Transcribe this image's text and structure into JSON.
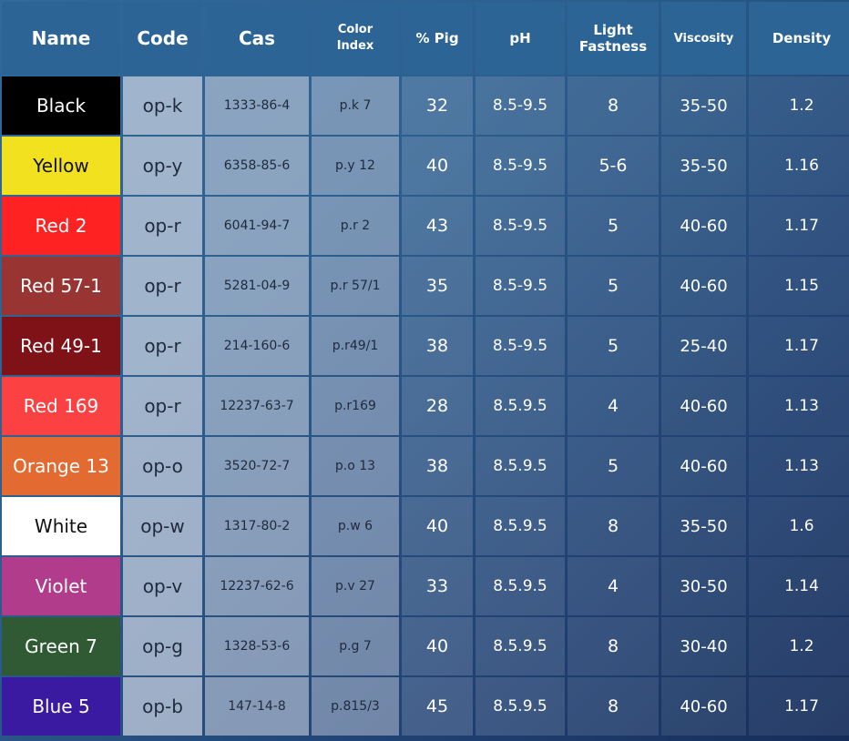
{
  "headers": [
    "Name",
    "Code",
    "Cas",
    "Color\nIndex",
    "% Pig",
    "pH",
    "Light\nFastness",
    "Viscosity",
    "Density"
  ],
  "rows": [
    {
      "name": "Black",
      "color": "#000000",
      "code": "op-k",
      "cas": "1333-86-4",
      "color_index": "p.k 7",
      "pig": "32",
      "ph": "8.5-9.5",
      "light_fastness": "8",
      "viscosity": "35-50",
      "density": "1.2"
    },
    {
      "name": "Yellow",
      "color": "#f2e11f",
      "code": "op-y",
      "cas": "6358-85-6",
      "color_index": "p.y 12",
      "pig": "40",
      "ph": "8.5-9.5",
      "light_fastness": "5-6",
      "viscosity": "35-50",
      "density": "1.16"
    },
    {
      "name": "Red 2",
      "color": "#ff2222",
      "code": "op-r",
      "cas": "6041-94-7",
      "color_index": "p.r 2",
      "pig": "43",
      "ph": "8.5-9.5",
      "light_fastness": "5",
      "viscosity": "40-60",
      "density": "1.17"
    },
    {
      "name": "Red 57-1",
      "color": "#983533",
      "code": "op-r",
      "cas": "5281-04-9",
      "color_index": "p.r 57/1",
      "pig": "35",
      "ph": "8.5-9.5",
      "light_fastness": "5",
      "viscosity": "40-60",
      "density": "1.15"
    },
    {
      "name": "Red 49-1",
      "color": "#7e1216",
      "code": "op-r",
      "cas": "214-160-6",
      "color_index": "p.r49/1",
      "pig": "38",
      "ph": "8.5-9.5",
      "light_fastness": "5",
      "viscosity": "25-40",
      "density": "1.17"
    },
    {
      "name": "Red 169",
      "color": "#fb4141",
      "code": "op-r",
      "cas": "12237-63-7",
      "color_index": "p.r169",
      "pig": "28",
      "ph": "8.5.9.5",
      "light_fastness": "4",
      "viscosity": "40-60",
      "density": "1.13"
    },
    {
      "name": "Orange 13",
      "color": "#e36a31",
      "code": "op-o",
      "cas": "3520-72-7",
      "color_index": "p.o 13",
      "pig": "38",
      "ph": "8.5.9.5",
      "light_fastness": "5",
      "viscosity": "40-60",
      "density": "1.13"
    },
    {
      "name": "White",
      "color": "#ffffff",
      "code": "op-w",
      "cas": "1317-80-2",
      "color_index": "p.w 6",
      "pig": "40",
      "ph": "8.5.9.5",
      "light_fastness": "8",
      "viscosity": "35-50",
      "density": "1.6"
    },
    {
      "name": "Violet",
      "color": "#b23c8c",
      "code": "op-v",
      "cas": "12237-62-6",
      "color_index": "p.v 27",
      "pig": "33",
      "ph": "8.5.9.5",
      "light_fastness": "4",
      "viscosity": "30-50",
      "density": "1.14"
    },
    {
      "name": "Green 7",
      "color": "#2f5a33",
      "code": "op-g",
      "cas": "1328-53-6",
      "color_index": "p.g 7",
      "pig": "40",
      "ph": "8.5.9.5",
      "light_fastness": "8",
      "viscosity": "30-40",
      "density": "1.2"
    },
    {
      "name": "Blue 5",
      "color": "#3a1aa0",
      "code": "op-b",
      "cas": "147-14-8",
      "color_index": "p.815/3",
      "pig": "45",
      "ph": "8.5.9.5",
      "light_fastness": "8",
      "viscosity": "40-60",
      "density": "1.17"
    }
  ]
}
